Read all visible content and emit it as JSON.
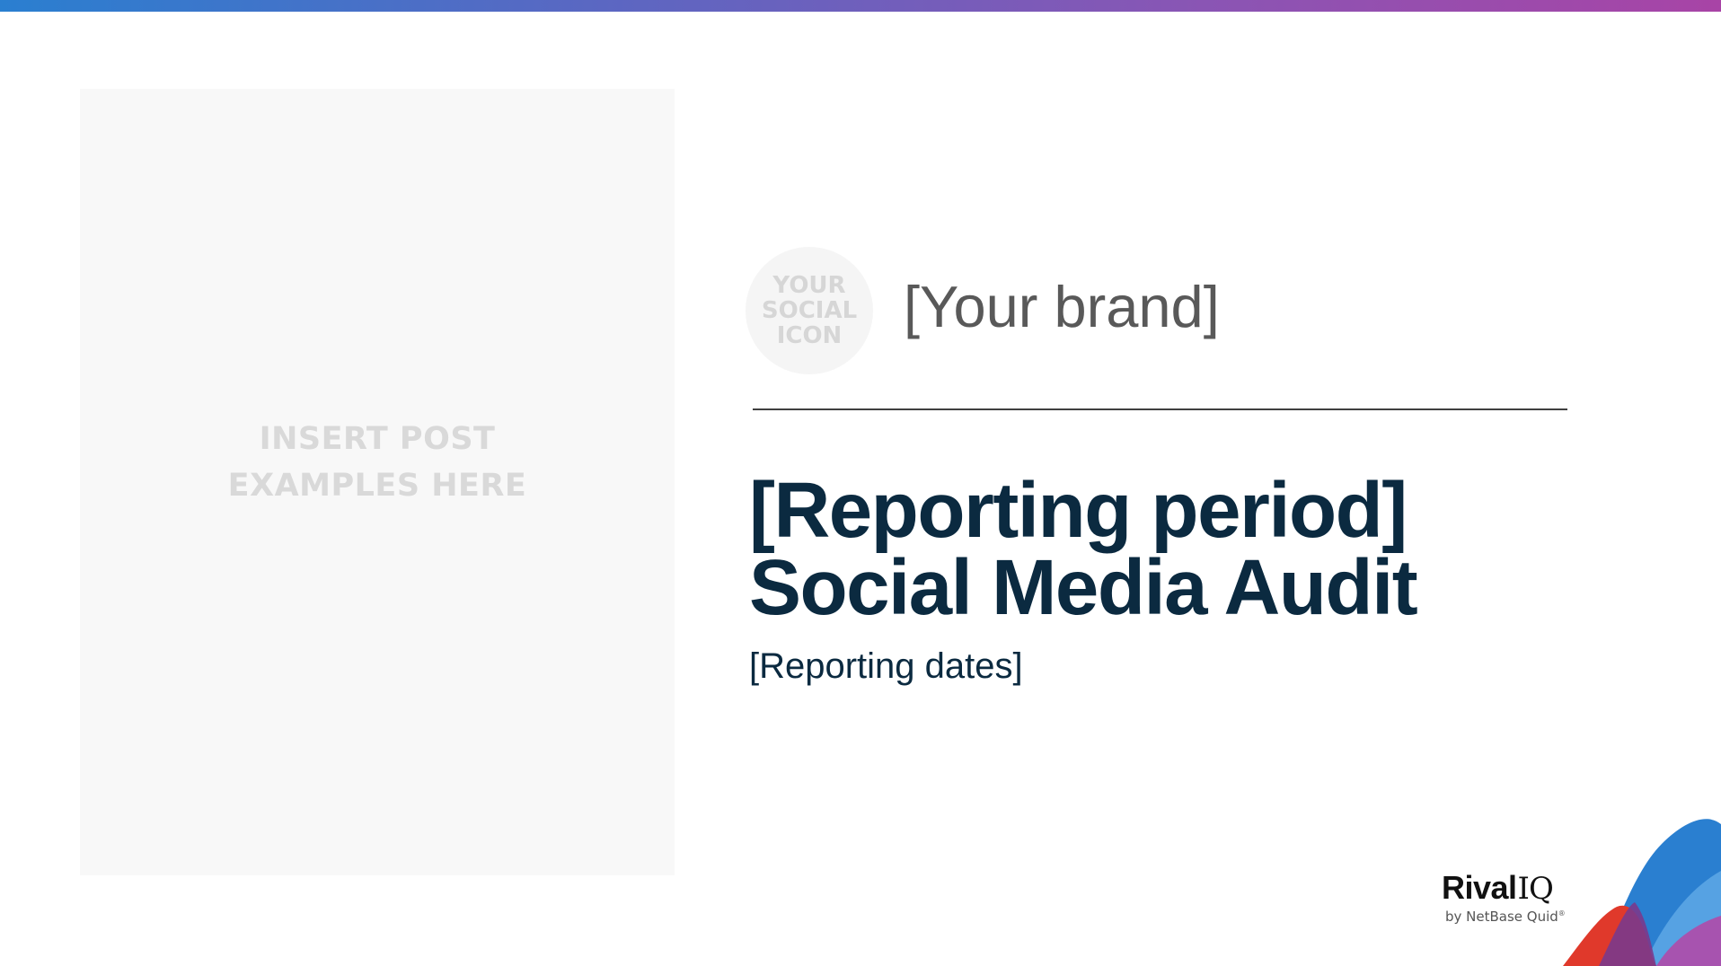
{
  "post_placeholder": {
    "line1": "INSERT POST",
    "line2": "EXAMPLES HERE"
  },
  "social_icon": {
    "line1": "YOUR",
    "line2": "SOCIAL",
    "line3": "ICON"
  },
  "brand": {
    "name": "[Your brand]"
  },
  "title": {
    "line1": "[Reporting period]",
    "line2": "Social Media Audit"
  },
  "subtitle": {
    "dates": "[Reporting dates]"
  },
  "logo": {
    "rival": "Rival",
    "iq": "IQ",
    "tagline": "by NetBase Quid",
    "trademark": "®"
  },
  "colors": {
    "title": "#0b2a40",
    "brand_text": "#595959",
    "placeholder_text": "#d9d9d9",
    "placeholder_bg": "#f8f8f8",
    "accent_blue": "#2a7fd0",
    "accent_purple": "#a844a6",
    "accent_red": "#e0392b"
  }
}
